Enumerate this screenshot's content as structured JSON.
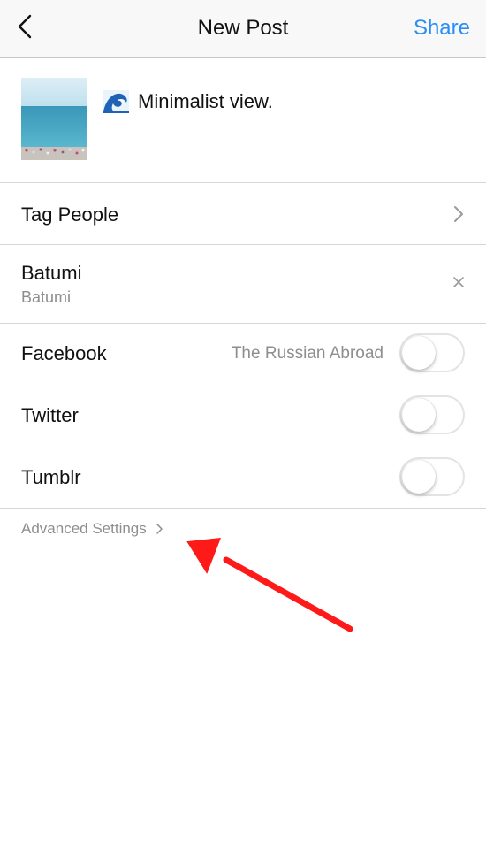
{
  "navbar": {
    "back_icon": "chevron-left-icon",
    "title": "New Post",
    "share_label": "Share",
    "accent_color": "#2b8ef3"
  },
  "post": {
    "caption_emoji_icon": "water-wave-emoji-icon",
    "caption": "Minimalist view."
  },
  "tag_people": {
    "label": "Tag People",
    "icon": "chevron-right-icon"
  },
  "location": {
    "title": "Batumi",
    "subtitle": "Batumi",
    "clear_icon": "close-icon"
  },
  "sharing": [
    {
      "label": "Facebook",
      "account": "The Russian Abroad",
      "enabled": false
    },
    {
      "label": "Twitter",
      "account": "",
      "enabled": false
    },
    {
      "label": "Tumblr",
      "account": "",
      "enabled": false
    }
  ],
  "advanced": {
    "label": "Advanced Settings",
    "icon": "chevron-right-icon"
  },
  "annotation": {
    "arrow_color": "#ff1a1a"
  }
}
